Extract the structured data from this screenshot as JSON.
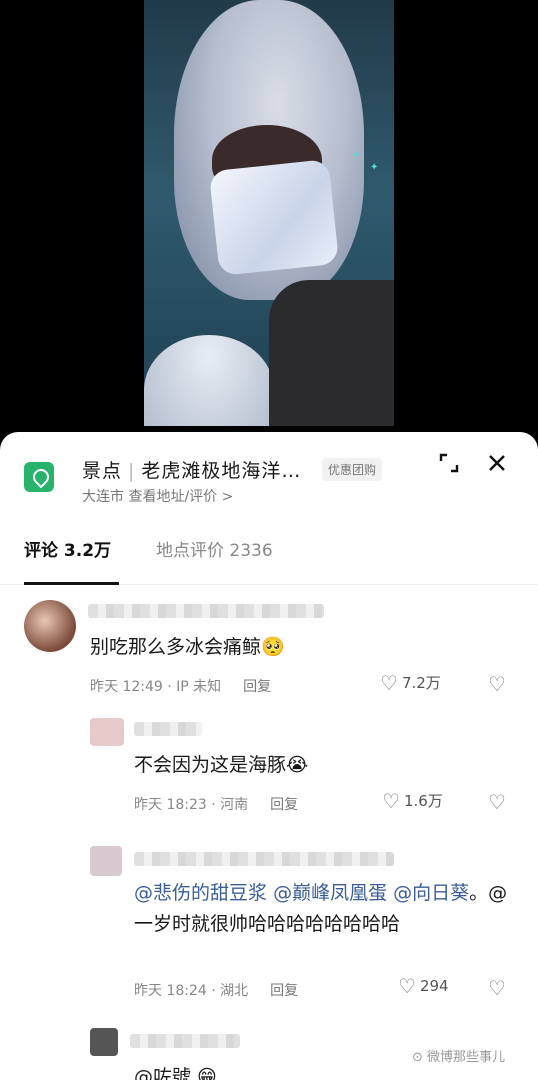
{
  "location": {
    "category": "景点",
    "name": "老虎滩极地海洋…",
    "tag": "优惠团购",
    "subtitle": "大连市  查看地址/评价 >"
  },
  "tabs": [
    {
      "label": "评论 3.2万",
      "active": true
    },
    {
      "label": "地点评价 2336",
      "active": false
    }
  ],
  "comments": [
    {
      "text": "别吃那么多冰会痛鲸🥺",
      "meta": "昨天 12:49 · IP 未知",
      "reply_label": "回复",
      "likes": "7.2万"
    },
    {
      "text": "不会因为这是海豚😭",
      "meta": "昨天 18:23 · 河南",
      "reply_label": "回复",
      "likes": "1.6万"
    },
    {
      "mention_1": "@悲伤的甜豆浆",
      "mention_2": "@巅峰凤凰蛋",
      "mention_3": "@向日葵",
      "text_rest": "。@一岁时就很帅哈哈哈哈哈哈哈哈",
      "meta": "昨天 18:24 · 湖北",
      "reply_label": "回复",
      "likes": "294"
    },
    {
      "text": "@咗號 😁"
    }
  ],
  "watermark": "微博那些事儿",
  "colors": {
    "poi_green": "#27b36b",
    "mention": "#3b5e9a",
    "sheet_bg": "#ffffff"
  }
}
